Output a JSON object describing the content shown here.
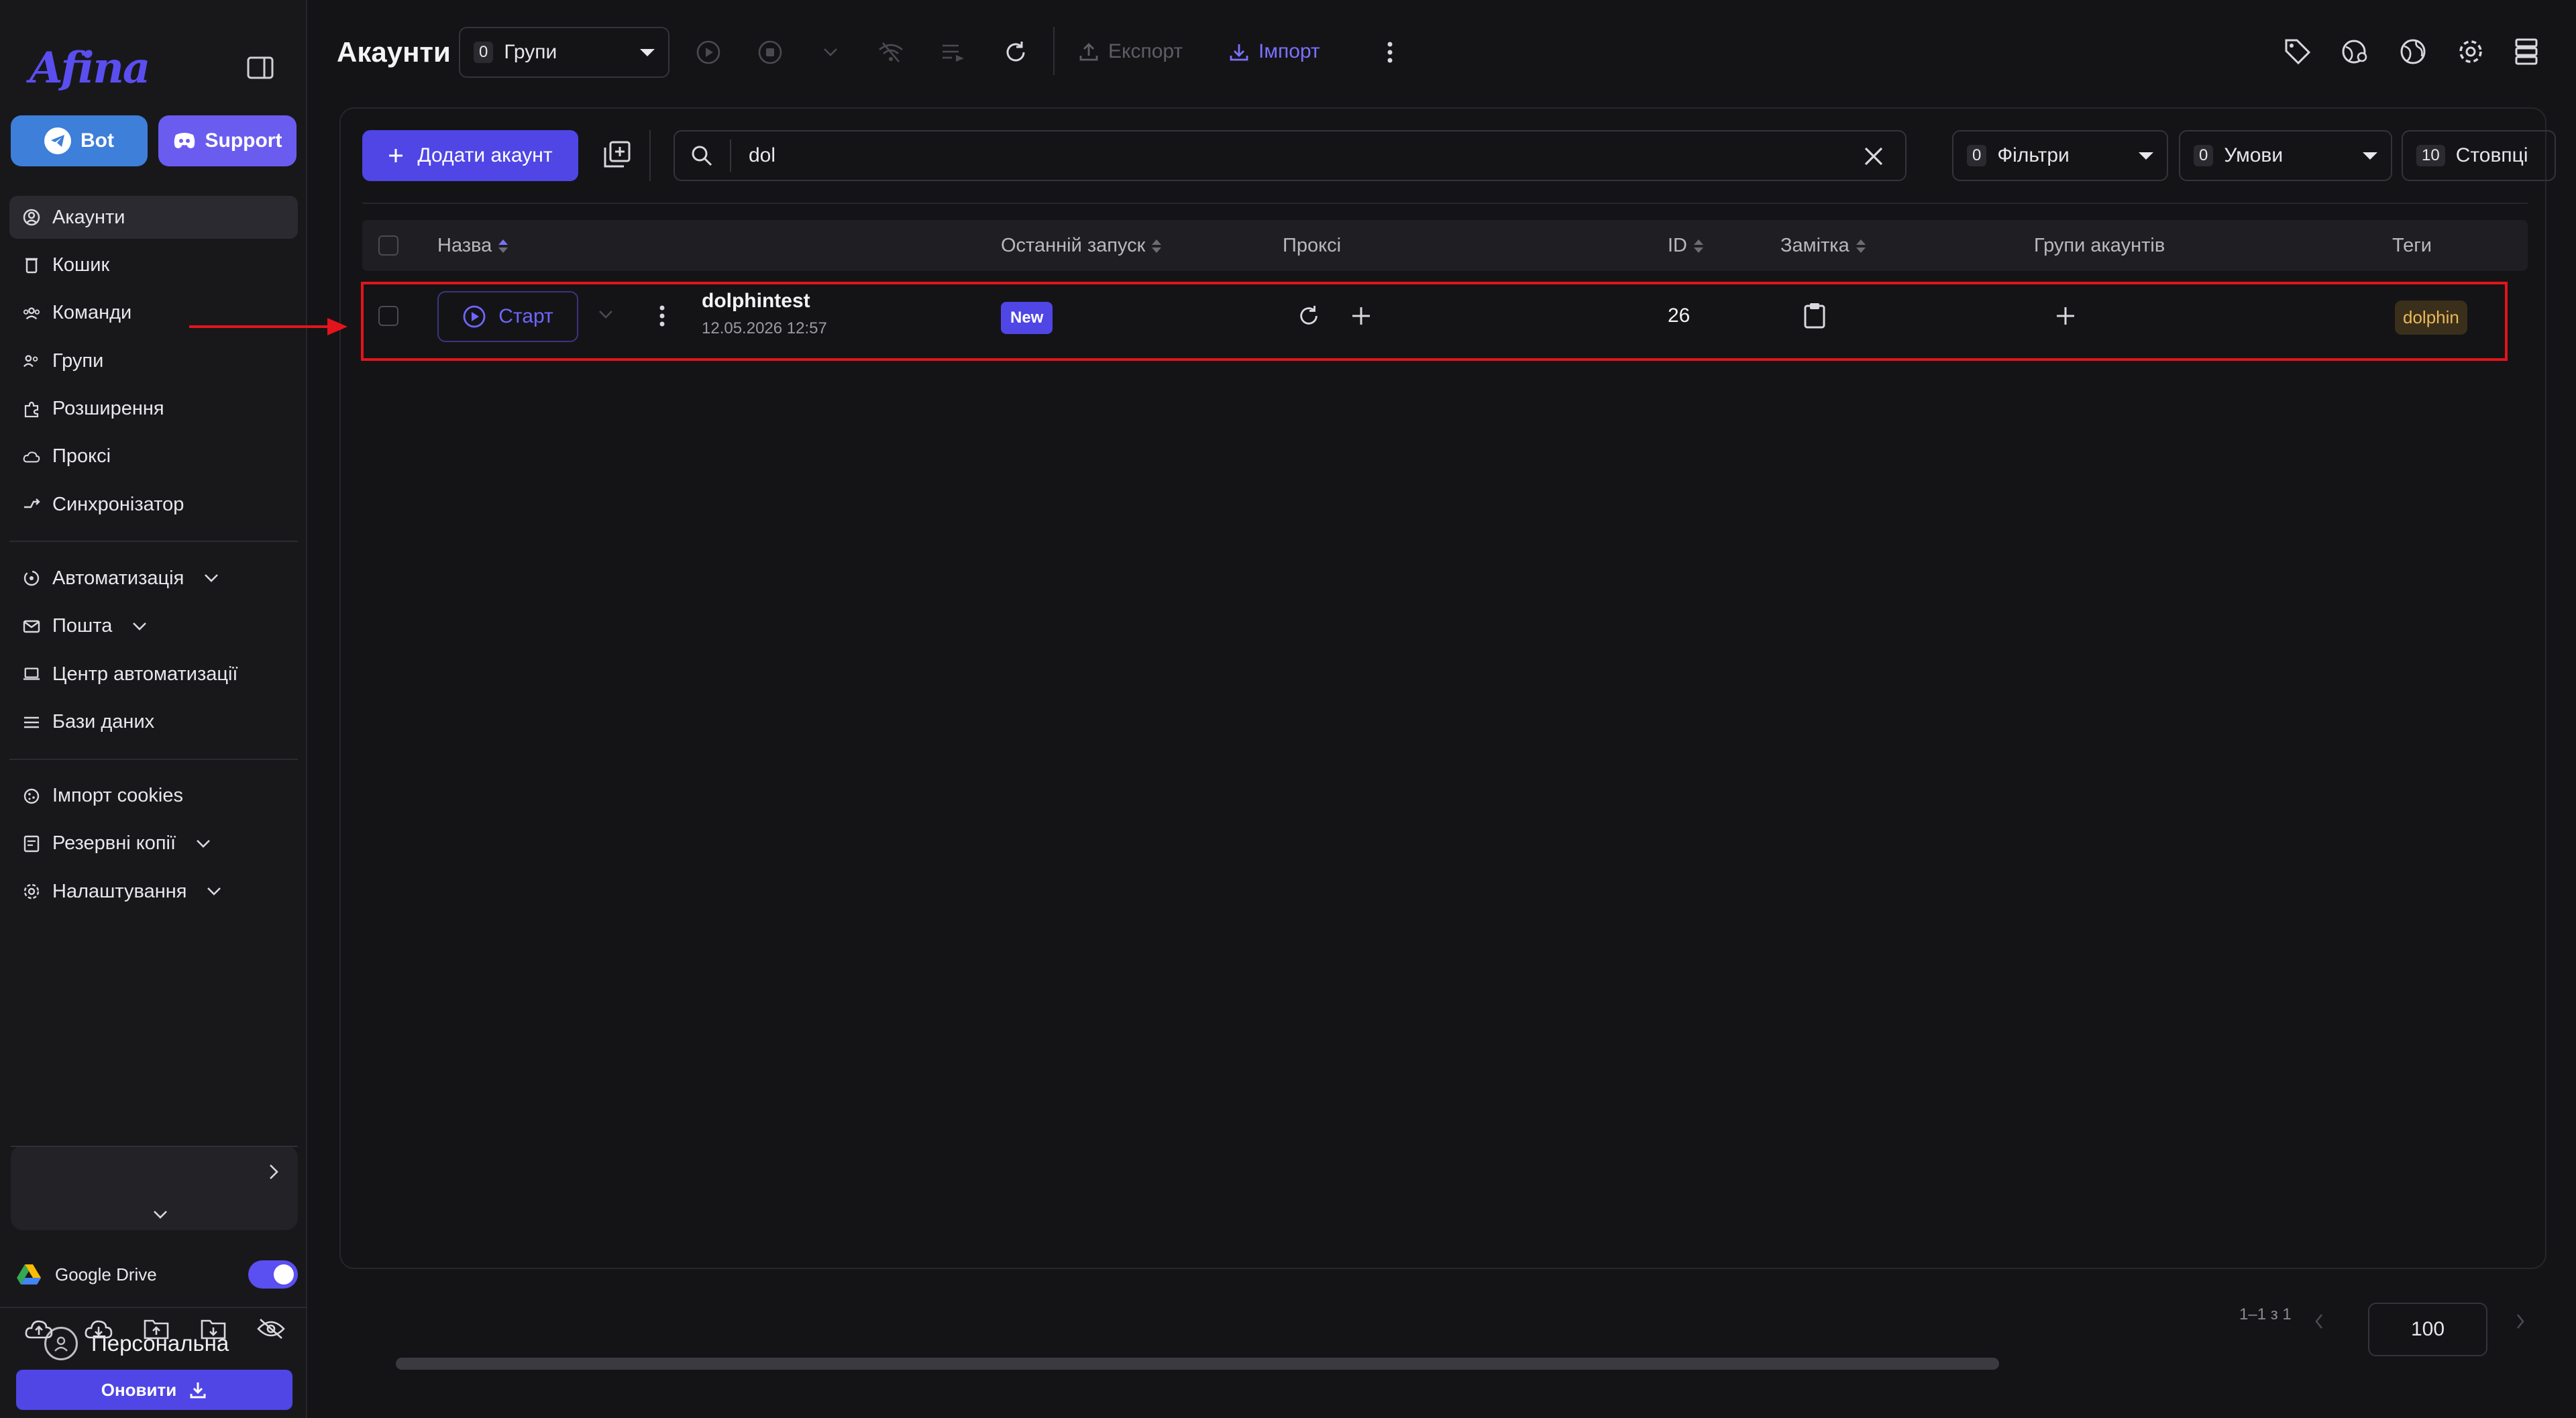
{
  "app": {
    "logo": "Afina"
  },
  "sidebar": {
    "bot_label": "Bot",
    "support_label": "Support",
    "nav_primary": [
      {
        "label": "Акаунти",
        "icon": "user-circle-icon",
        "active": true
      },
      {
        "label": "Кошик",
        "icon": "trash-icon"
      },
      {
        "label": "Команди",
        "icon": "team-icon"
      },
      {
        "label": "Групи",
        "icon": "groups-icon"
      },
      {
        "label": "Розширення",
        "icon": "puzzle-icon"
      },
      {
        "label": "Проксі",
        "icon": "cloud-icon"
      },
      {
        "label": "Синхронізатор",
        "icon": "sync-icon"
      }
    ],
    "nav_secondary": [
      {
        "label": "Автоматизація",
        "icon": "automation-icon",
        "expandable": true
      },
      {
        "label": "Пошта",
        "icon": "mail-icon",
        "expandable": true
      },
      {
        "label": "Центр автоматизації",
        "icon": "laptop-icon"
      },
      {
        "label": "Бази даних",
        "icon": "list-icon"
      }
    ],
    "nav_tertiary": [
      {
        "label": "Імпорт cookies",
        "icon": "cookie-icon"
      },
      {
        "label": "Резервні копії",
        "icon": "backup-icon",
        "expandable": true
      },
      {
        "label": "Налаштування",
        "icon": "gear-icon",
        "expandable": true
      }
    ],
    "workspace_label": "Персональна",
    "gdrive_label": "Google Drive",
    "gdrive_enabled": true,
    "update_label": "Оновити"
  },
  "toolbar": {
    "title": "Акаунти",
    "groups_count": "0",
    "groups_label": "Групи",
    "export_label": "Експорт",
    "import_label": "Імпорт"
  },
  "controls": {
    "add_account_label": "Додати акаунт",
    "search_value": "dol",
    "filters_count": "0",
    "filters_label": "Фільтри",
    "conditions_count": "0",
    "conditions_label": "Умови",
    "columns_count": "10",
    "columns_label": "Стовпці"
  },
  "table": {
    "headers": {
      "name": "Назва",
      "last_run": "Останній запуск",
      "proxy": "Проксі",
      "id": "ID",
      "note": "Замітка",
      "account_groups": "Групи акаунтів",
      "tags": "Теги"
    },
    "rows": [
      {
        "start_label": "Старт",
        "name": "dolphintest",
        "date": "12.05.2026 12:57",
        "last_run_badge": "New",
        "id": "26",
        "tag": "dolphin"
      }
    ]
  },
  "pagination": {
    "range": "1–1 з 1",
    "page_size": "100"
  },
  "colors": {
    "accent": "#4f46e5",
    "highlight": "#e3141b",
    "tag_bg": "#3a2f1a",
    "tag_text": "#e9b959"
  }
}
